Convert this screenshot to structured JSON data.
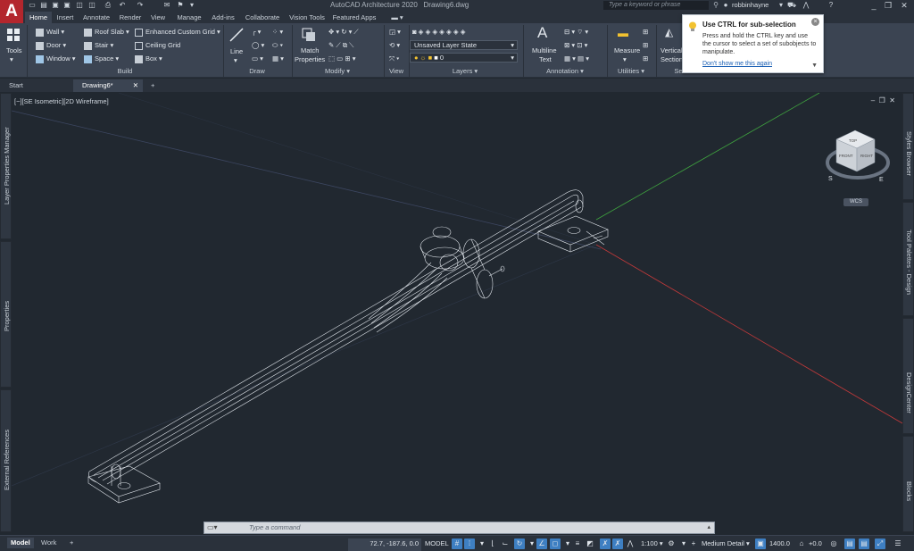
{
  "app": {
    "title": "AutoCAD Architecture 2020",
    "file": "Drawing6.dwg",
    "logo": "A"
  },
  "search": {
    "placeholder": "Type a keyword or phrase"
  },
  "user": {
    "name": "robbinhayne"
  },
  "ribbon_tabs": [
    "Home",
    "Insert",
    "Annotate",
    "Render",
    "View",
    "Manage",
    "Add-ins",
    "Collaborate",
    "Vision Tools",
    "Featured Apps"
  ],
  "ribbon": {
    "tools_label": "Tools",
    "build": {
      "label": "Build",
      "items": [
        "Wall",
        "Door",
        "Window",
        "Roof Slab",
        "Stair",
        "Space",
        "Enhanced Custom Grid",
        "Ceiling Grid",
        "Box"
      ]
    },
    "draw": {
      "label": "Draw",
      "line": "Line"
    },
    "modify": {
      "label": "Modify",
      "match": "Match",
      "properties": "Properties"
    },
    "view": {
      "label": "View"
    },
    "layers": {
      "label": "Layers",
      "state": "Unsaved Layer State",
      "layer": "0"
    },
    "annotation": {
      "label": "Annotation",
      "multiline": "Multiline",
      "text": "Text"
    },
    "utilities": {
      "label": "Utilities",
      "measure": "Measure"
    },
    "section": {
      "vertical": "Vertical",
      "section": "Section",
      "short": "Se"
    }
  },
  "file_tabs": [
    "Start",
    "Drawing6*"
  ],
  "viewport": {
    "label": "[−][SE Isometric][2D Wireframe]",
    "wcs": "WCS"
  },
  "viewcube": {
    "top": "TOP",
    "front": "FRONT",
    "right": "RIGHT",
    "s": "S",
    "e": "E"
  },
  "palettes_left": [
    "Layer Properties Manager",
    "Properties",
    "External References"
  ],
  "palettes_right": [
    "Styles Browser",
    "Tool Palettes - Design",
    "DesignCenter",
    "Blocks"
  ],
  "command": {
    "placeholder": "Type a command"
  },
  "status": {
    "tabs": [
      "Model",
      "Work"
    ],
    "coords": "72.7, -187.6, 0.0",
    "model": "MODEL",
    "scale": "1:100",
    "detail": "Medium Detail",
    "elevation": "1400.0",
    "offset": "+0.0"
  },
  "tooltip": {
    "title": "Use CTRL for sub-selection",
    "body": "Press and hold the CTRL key and use the cursor to select a set of subobjects to manipulate.",
    "link": "Don't show me this again"
  },
  "colors": {
    "accent": "#3e7fc2",
    "logo": "#b3262d",
    "axis_x": "#c0393a",
    "axis_y": "#3fa33f"
  }
}
